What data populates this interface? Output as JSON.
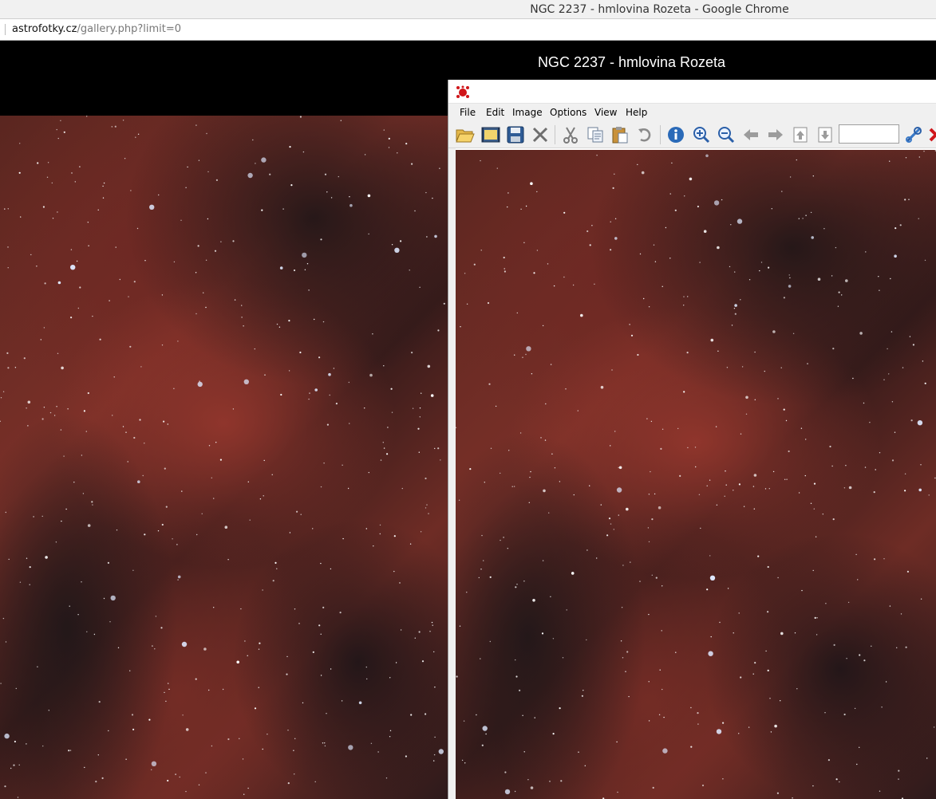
{
  "browser": {
    "window_title": "NGC 2237 - hmlovina Rozeta - Google Chrome",
    "url_host": "astrofotky.cz",
    "url_path": "/gallery.php?limit=0"
  },
  "page": {
    "title": "NGC 2237 - hmlovina Rozeta"
  },
  "viewer": {
    "menu": [
      "File",
      "Edit",
      "Image",
      "Options",
      "View",
      "Help"
    ],
    "zoom_value": "",
    "toolbar_icons": [
      "open-folder-icon",
      "slideshow-icon",
      "save-icon",
      "delete-icon",
      "cut-icon",
      "copy-icon",
      "paste-icon",
      "undo-icon",
      "info-icon",
      "zoom-in-icon",
      "zoom-out-icon",
      "previous-icon",
      "next-icon",
      "page-up-icon",
      "page-down-icon",
      "settings-icon",
      "exit-icon"
    ]
  },
  "colors": {
    "nebula_red": "#8a3a30",
    "page_background": "#000000"
  }
}
